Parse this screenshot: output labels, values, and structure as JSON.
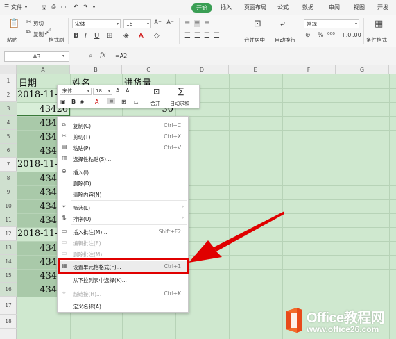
{
  "menubar": {
    "file_label": "文件",
    "tabs": [
      "开始",
      "插入",
      "页面布局",
      "公式",
      "数据",
      "审阅",
      "视图",
      "开发"
    ]
  },
  "ribbon": {
    "paste": "粘贴",
    "cut": "剪切",
    "copy": "复制",
    "format_painter": "格式刷",
    "font_name": "宋体",
    "font_size": "18",
    "merge_center": "合并居中",
    "wrap_text": "自动换行",
    "number_format": "常规",
    "conditional_format": "条件格式"
  },
  "formula_bar": {
    "name_box": "A3",
    "fx": "fx",
    "formula": "=A2"
  },
  "columns": [
    "A",
    "B",
    "C",
    "D",
    "E",
    "F",
    "G"
  ],
  "rows": [
    "1",
    "2",
    "3",
    "4",
    "5",
    "6",
    "7",
    "8",
    "9",
    "10",
    "11",
    "12",
    "13",
    "14",
    "15",
    "16",
    "17",
    "18"
  ],
  "cells": {
    "a1": "日期",
    "b1": "姓名",
    "c1": "进货量",
    "a2": "2018-11-",
    "a3": "43426",
    "c3": "30",
    "a4": "434",
    "a5": "434",
    "a6": "434",
    "a7": "2018-11-",
    "a8": "434",
    "a9": "434",
    "a10": "434",
    "a11": "434",
    "a12": "2018-11-",
    "a13": "434",
    "a14": "434",
    "a15": "434",
    "a16": "434"
  },
  "mini_toolbar": {
    "font_name": "宋体",
    "font_size": "18",
    "merge": "合并",
    "autosum": "自动求和"
  },
  "context_menu": {
    "copy": {
      "label": "复制(C)",
      "shortcut": "Ctrl+C"
    },
    "cut": {
      "label": "剪切(T)",
      "shortcut": "Ctrl+X"
    },
    "paste": {
      "label": "粘贴(P)",
      "shortcut": "Ctrl+V"
    },
    "paste_special": {
      "label": "选择性粘贴(S)..."
    },
    "insert": {
      "label": "插入(I)..."
    },
    "delete": {
      "label": "删除(D)..."
    },
    "clear": {
      "label": "清除内容(N)"
    },
    "filter": {
      "label": "筛选(L)"
    },
    "sort": {
      "label": "排序(U)"
    },
    "insert_comment": {
      "label": "插入批注(M)...",
      "shortcut": "Shift+F2"
    },
    "edit_comment": {
      "label": "编辑批注(E)..."
    },
    "delete_comment": {
      "label": "删除批注(M)"
    },
    "format_cells": {
      "label": "设置单元格格式(F)...",
      "shortcut": "Ctrl+1"
    },
    "pick_from_list": {
      "label": "从下拉列表中选择(K)..."
    },
    "hyperlink": {
      "label": "超链接(H)...",
      "shortcut": "Ctrl+K"
    },
    "define_name": {
      "label": "定义名称(A)..."
    }
  },
  "watermark": {
    "title": "Office教程网",
    "url": "www.office26.com"
  },
  "colors": {
    "accent": "#3a9e54",
    "highlight": "#e00000",
    "sheet_bg": "#cfe8cf"
  }
}
